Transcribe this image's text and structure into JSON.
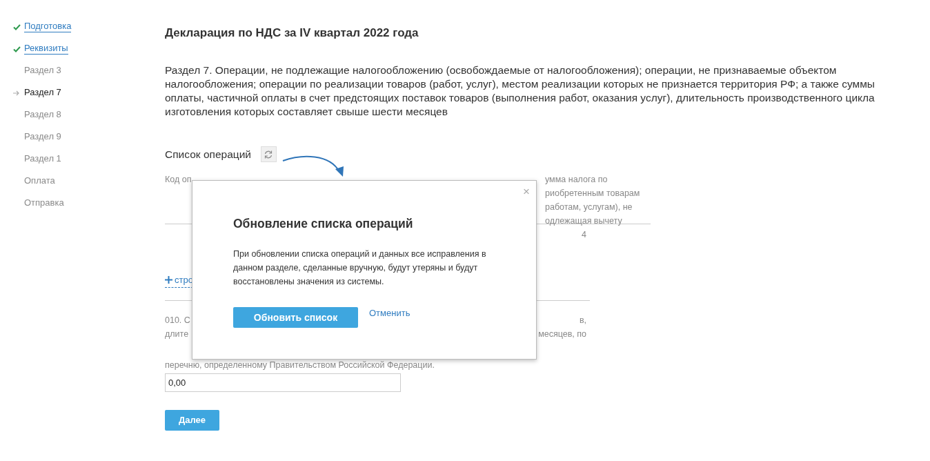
{
  "sidebar": {
    "items": [
      {
        "label": "Подготовка",
        "kind": "done"
      },
      {
        "label": "Реквизиты",
        "kind": "done"
      },
      {
        "label": "Раздел 3",
        "kind": "pending"
      },
      {
        "label": "Раздел 7",
        "kind": "current"
      },
      {
        "label": "Раздел 8",
        "kind": "pending"
      },
      {
        "label": "Раздел 9",
        "kind": "pending"
      },
      {
        "label": "Раздел 1",
        "kind": "pending"
      },
      {
        "label": "Оплата",
        "kind": "pending"
      },
      {
        "label": "Отправка",
        "kind": "pending"
      }
    ]
  },
  "title": "Декларация по НДС за IV квартал 2022 года",
  "section_text": "Раздел 7. Операции, не подлежащие налогообложению (освобождаемые от налогообложения); операции, не признаваемые объектом налогообложения; операции по реализации товаров (работ, услуг), местом реализации которых не признается территория РФ; а также суммы оплаты, частичной оплаты в счет предстоящих поставок товаров (выполнения работ, оказания услуг), длительность производственного цикла изготовления которых составляет свыше шести месяцев",
  "operations": {
    "label": "Список операций",
    "table": {
      "column_1": "Код оп",
      "column_last": [
        "умма налога по",
        "риобретенным товарам",
        "работам, услугам), не",
        "одлежащая вычету"
      ],
      "column_last_number": "4"
    },
    "add_row": "стро"
  },
  "field_010": {
    "label_left": [
      "010. С",
      "длите"
    ],
    "label_right": [
      "в,",
      "месяцев, по"
    ],
    "label_last": "перечню, определенному Правительством Российской Федерации.",
    "value": "0,00"
  },
  "next_button": "Далее",
  "dialog": {
    "title": "Обновление списка операций",
    "close": "×",
    "text": "При обновлении списка операций и данных все исправления в данном разделе, сделанные вручную, будут утеряны и будут восстановлены значения из системы.",
    "primary": "Обновить список",
    "cancel": "Отменить"
  }
}
